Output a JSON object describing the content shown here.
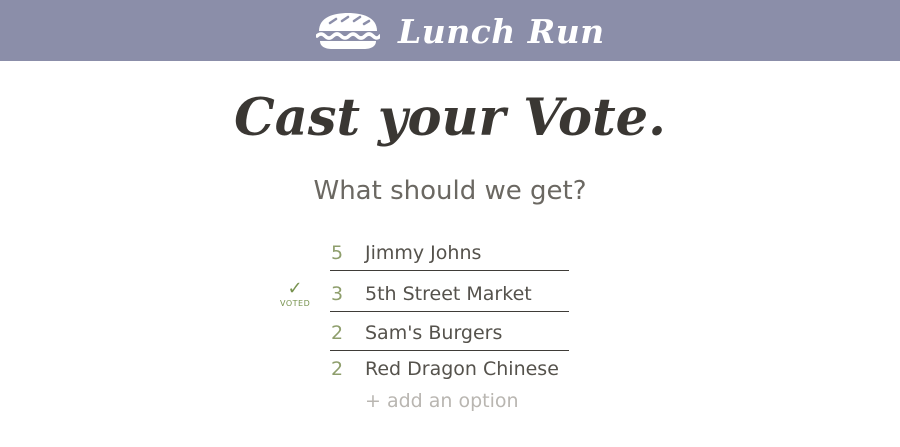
{
  "header": {
    "app_name": "Lunch Run",
    "logo_icon": "sandwich-icon",
    "background_color": "#8b8ea9"
  },
  "main": {
    "headline": "Cast your Vote.",
    "question": "What should we get?"
  },
  "options": [
    {
      "count": "5",
      "name": "Jimmy Johns",
      "voted": false
    },
    {
      "count": "3",
      "name": "5th Street Market",
      "voted": true
    },
    {
      "count": "2",
      "name": "Sam's Burgers",
      "voted": false
    },
    {
      "count": "2",
      "name": "Red Dragon Chinese",
      "voted": false
    }
  ],
  "voted_indicator": {
    "check_glyph": "✓",
    "label": "VOTED",
    "color": "#789350"
  },
  "add_option_label": "+ add an option"
}
